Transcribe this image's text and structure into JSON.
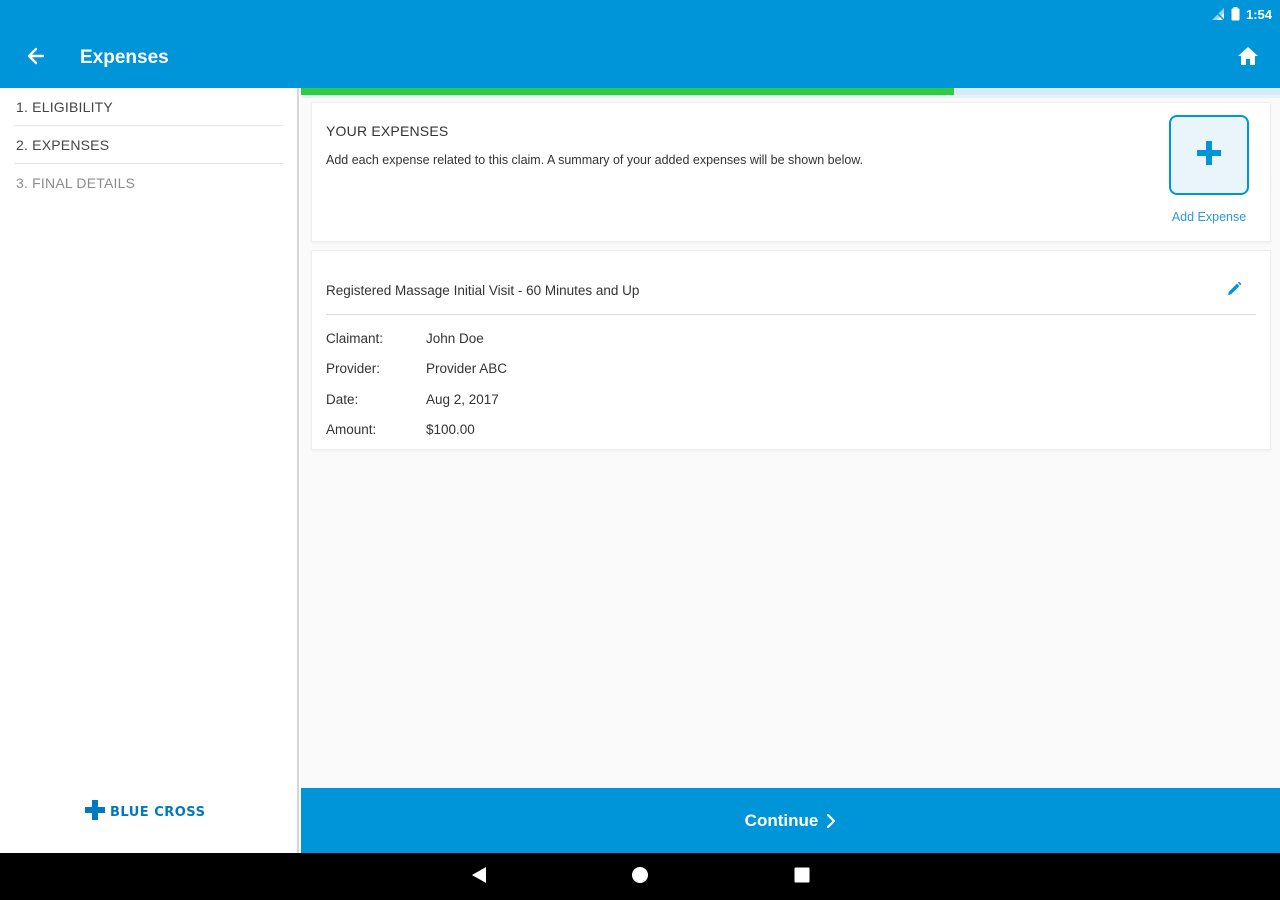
{
  "status_bar": {
    "time": "1:54",
    "icons": [
      "signal-icon",
      "battery-icon"
    ]
  },
  "app_bar": {
    "title": "Expenses",
    "back_icon": "back-arrow-icon",
    "home_icon": "home-icon"
  },
  "sidebar": {
    "steps": [
      {
        "label": "1. ELIGIBILITY",
        "state": "done"
      },
      {
        "label": "2. EXPENSES",
        "state": "current"
      },
      {
        "label": "3. FINAL DETAILS",
        "state": "disabled"
      }
    ],
    "logo_text": "BLUE CROSS"
  },
  "progress": {
    "value": 0.667,
    "fill_color": "#2ecc40"
  },
  "expenses_card": {
    "title": "YOUR EXPENSES",
    "description": "Add each expense related to this claim. A summary of your added expenses will be shown below.",
    "add_label": "Add Expense"
  },
  "expense_item": {
    "title": "Registered Massage Initial Visit - 60 Minutes and Up",
    "details": [
      {
        "label": "Claimant:",
        "value": "John Doe"
      },
      {
        "label": "Provider:",
        "value": "Provider ABC"
      },
      {
        "label": "Date:",
        "value": "Aug 2, 2017"
      },
      {
        "label": "Amount:",
        "value": "$100.00"
      }
    ]
  },
  "continue_button": {
    "label": "Continue"
  },
  "colors": {
    "primary": "#0095d8",
    "progress": "#2ecc40"
  }
}
